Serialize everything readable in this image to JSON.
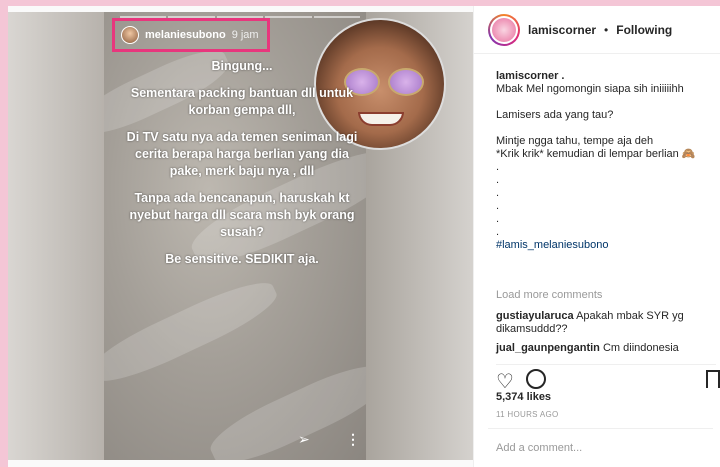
{
  "story": {
    "username": "melaniesubono",
    "time": "9 jam",
    "paragraphs": [
      "Bingung...",
      "Sementara packing bantuan dll untuk korban gempa dll,",
      "Di TV satu nya ada temen seniman lagi cerita berapa harga berlian yang dia pake, merk baju nya , dll",
      "Tanpa ada bencanapun, haruskah kt nyebut harga dll scara msh byk orang susah?",
      "Be sensitive. SEDIKIT aja."
    ],
    "accent_color": "#e8367d"
  },
  "header": {
    "username": "lamiscorner",
    "separator": "•",
    "follow_status": "Following"
  },
  "caption": {
    "username": "lamiscorner .",
    "lines": [
      "Mbak Mel ngomongin siapa sih iniiiiihh",
      "",
      "Lamisers ada yang tau?",
      "",
      "Mintje ngga tahu, tempe aja deh",
      "*Krik krik* kemudian di lempar berlian 🙈",
      ".",
      ".",
      ".",
      ".",
      ".",
      "."
    ],
    "hashtag": "#lamis_melaniesubono"
  },
  "load_more": "Load more comments",
  "comments": [
    {
      "user": "gustiayularuca",
      "text": "Apakah mbak SYR yg dikamsuddd??"
    },
    {
      "user": "jual_gaunpengantin",
      "text": "Cm diindonesia"
    }
  ],
  "likes": "5,374 likes",
  "time_ago": "11 HOURS AGO",
  "add_comment_placeholder": "Add a comment..."
}
